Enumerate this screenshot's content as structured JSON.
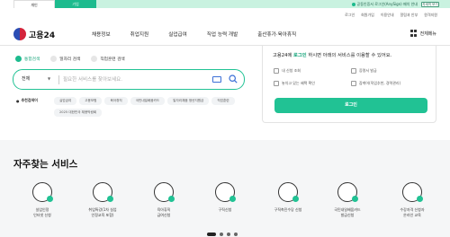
{
  "topbar": {
    "personal": "개인",
    "company": "기업",
    "notice": "공동인증서 로그인(AnySign) 패치 안내",
    "more": "자세히 보기"
  },
  "util": [
    "로그인",
    "회원가입",
    "이용안내",
    "알림과 안부",
    "원격지원"
  ],
  "brand": {
    "name": "고용24"
  },
  "nav": [
    "채용정보",
    "취업지원",
    "실업급여",
    "직업 능력 개발",
    "출산휴가·육아휴직"
  ],
  "menu_all": "전체메뉴",
  "search": {
    "tabs": [
      "통합검색",
      "일자리 검색",
      "직업훈련 검색"
    ],
    "scope": "전체",
    "placeholder": "필요한 서비스를 찾아보세요.",
    "recommend_label": "추천검색어",
    "keywords": [
      "실업급여",
      "고용보험",
      "육아휴직",
      "국민내일배움카드",
      "일자리채움 청년지원금",
      "직업훈련",
      "2025 대한민국 채용박람회"
    ]
  },
  "login": {
    "msg_pre": "고용24에 ",
    "msg_link": "로그인",
    "msg_post": " 하시면 아래의 서비스를 이용할 수 있어요.",
    "links": [
      "내 신청 조회",
      "증명서 발급",
      "놓치고 있는 혜택 확인",
      "잡케어(직업추천, 경력관리)"
    ],
    "button": "로그인"
  },
  "services": {
    "title": "자주찾는 서비스",
    "items": [
      {
        "label1": "실업인정",
        "label2": "인터넷 신청",
        "icon": "document-icon"
      },
      {
        "label1": "취업특강(1차 실업",
        "label2": "인정교육 포함)",
        "icon": "presentation-icon"
      },
      {
        "label1": "육아휴직",
        "label2": "급여신청",
        "icon": "bottle-icon"
      },
      {
        "label1": "구직신청",
        "label2": "",
        "icon": "person-icon"
      },
      {
        "label1": "구직촉진수당 신청",
        "label2": "",
        "icon": "coin-icon"
      },
      {
        "label1": "국민내일배움카드",
        "label2": "발급신청",
        "icon": "card-icon"
      },
      {
        "label1": "수강자격 신청자",
        "label2": "온라인 교육",
        "icon": "monitor-icon"
      }
    ]
  },
  "colors": {
    "accent": "#21c294",
    "accent_dark": "#19a57c"
  }
}
